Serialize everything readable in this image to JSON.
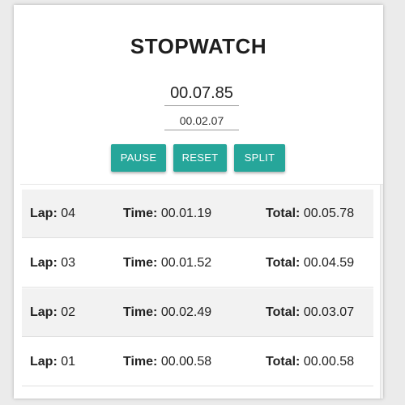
{
  "app": {
    "title": "STOPWATCH",
    "main_time": "00.07.85",
    "split_time": "00.02.07"
  },
  "buttons": {
    "pause": "PAUSE",
    "reset": "RESET",
    "split": "SPLIT"
  },
  "labels": {
    "lap": "Lap:",
    "time": "Time:",
    "total": "Total:"
  },
  "laps": [
    {
      "lap": "04",
      "time": "00.01.19",
      "total": "00.05.78"
    },
    {
      "lap": "03",
      "time": "00.01.52",
      "total": "00.04.59"
    },
    {
      "lap": "02",
      "time": "00.02.49",
      "total": "00.03.07"
    },
    {
      "lap": "01",
      "time": "00.00.58",
      "total": "00.00.58"
    }
  ],
  "colors": {
    "button": "#26a69a",
    "row_alt": "#f2f2f2"
  }
}
